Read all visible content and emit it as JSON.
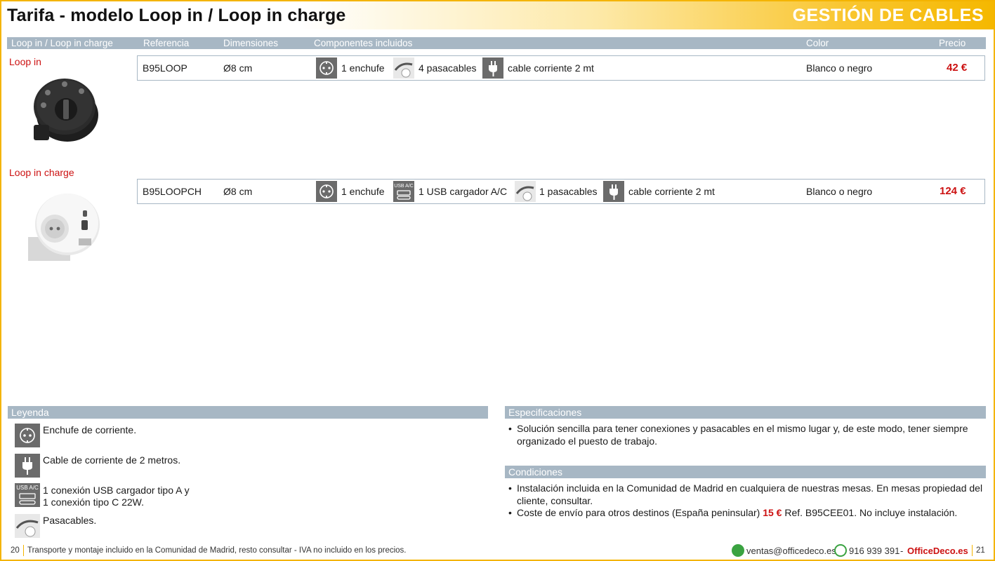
{
  "header": {
    "title": "Tarifa - modelo Loop in / Loop in charge",
    "section": "GESTIÓN DE CABLES"
  },
  "columns": {
    "product": "Loop in / Loop in charge",
    "reference": "Referencia",
    "dimensions": "Dimensiones",
    "components": "Componentes incluidos",
    "color": "Color",
    "price": "Precio"
  },
  "products": [
    {
      "name": "Loop in",
      "reference": "B95LOOP",
      "dimensions": "Ø8 cm",
      "components": [
        {
          "icon": "socket-icon",
          "label": "1 enchufe"
        },
        {
          "icon": "cable-pass-icon",
          "label": "4 pasacables"
        },
        {
          "icon": "plug-icon",
          "label": "cable corriente 2 mt"
        }
      ],
      "color": "Blanco o negro",
      "price": "42 €"
    },
    {
      "name": "Loop in charge",
      "reference": "B95LOOPCH",
      "dimensions": "Ø8 cm",
      "components": [
        {
          "icon": "socket-icon",
          "label": "1 enchufe"
        },
        {
          "icon": "usb-icon",
          "label": "1 USB cargador A/C"
        },
        {
          "icon": "cable-pass-icon",
          "label": "1 pasacables"
        },
        {
          "icon": "plug-icon",
          "label": "cable corriente 2 mt"
        }
      ],
      "color": "Blanco o negro",
      "price": "124 €"
    }
  ],
  "usb_icon_text": "USB A/C",
  "legend": {
    "title": "Leyenda",
    "items": [
      {
        "icon": "socket-icon",
        "text": "Enchufe de corriente."
      },
      {
        "icon": "plug-icon",
        "text": "Cable de corriente de 2 metros."
      },
      {
        "icon": "usb-icon",
        "text_line1": "1 conexión USB cargador tipo A y",
        "text_line2": "1 conexión tipo C 22W."
      },
      {
        "icon": "cable-pass-icon",
        "text": "Pasacables."
      }
    ]
  },
  "specs": {
    "title": "Especificaciones",
    "items": [
      "Solución sencilla para tener conexiones y pasacables en el mismo lugar y, de este modo, tener siempre organizado el puesto de trabajo."
    ]
  },
  "conditions": {
    "title": "Condiciones",
    "item1": "Instalación incluida en la Comunidad de Madrid en cualquiera de nuestras mesas. En mesas propiedad del cliente, consultar.",
    "item2_before": "Coste de envío para otros destinos (España peninsular) ",
    "item2_price": "15 €",
    "item2_after": " Ref. B95CEE01. No incluye instalación."
  },
  "footer": {
    "page_left": "20",
    "note": "Transporte y montaje incluido en la Comunidad de Madrid, resto consultar - IVA no incluido en los precios.",
    "email": "ventas@officedeco.es",
    "phone": "916 939 391",
    "dash": "-",
    "brand": "OfficeDeco.es",
    "page_right": "21"
  },
  "colors": {
    "accent": "#f4b400",
    "bar": "#a7b7c4",
    "price": "#cc1111",
    "icon_bg": "#6b6b6b"
  }
}
